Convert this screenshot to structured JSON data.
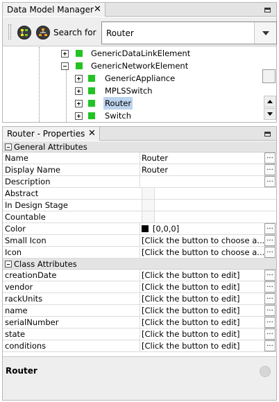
{
  "tree_panel": {
    "tab_title": "Data Model Manager",
    "close_glyph": "✕",
    "search_label": "Search for",
    "search_value": "Router",
    "tree_items": [
      {
        "label": "GenericDataLinkElement",
        "expander": "plus"
      },
      {
        "label": "GenericNetworkElement",
        "expander": "minus"
      },
      {
        "label": "GenericAppliance",
        "expander": "plus"
      },
      {
        "label": "MPLSSwitch",
        "expander": "plus"
      },
      {
        "label": "Router",
        "expander": "plus",
        "selected": true
      },
      {
        "label": "Switch",
        "expander": "plus"
      }
    ],
    "node_color": "#22c322",
    "selection_color": "#bcd3ee"
  },
  "properties_panel": {
    "tab_title": "Router - Properties",
    "close_glyph": "✕",
    "general_header": "General Attributes",
    "general_rows": [
      {
        "name": "Name",
        "value": "Router",
        "editor": true
      },
      {
        "name": "Display Name",
        "value": "Router",
        "editor": true
      },
      {
        "name": "Description",
        "value": "",
        "editor": true
      },
      {
        "name": "Abstract",
        "checkbox": true
      },
      {
        "name": "In Design Stage",
        "checkbox": true
      },
      {
        "name": "Countable",
        "checkbox": true
      },
      {
        "name": "Color",
        "value": "[0,0,0]",
        "editor": true,
        "swatch": "#000000"
      },
      {
        "name": "Small Icon",
        "value": "[Click the button to choose a...",
        "editor": true
      },
      {
        "name": "Icon",
        "value": "[Click the button to choose a...",
        "editor": true
      }
    ],
    "class_header": "Class Attributes",
    "class_rows": [
      {
        "name": "creationDate",
        "value": "[Click the button to edit]"
      },
      {
        "name": "vendor",
        "value": "[Click the button to edit]"
      },
      {
        "name": "rackUnits",
        "value": "[Click the button to edit]"
      },
      {
        "name": "name",
        "value": "[Click the button to edit]"
      },
      {
        "name": "serialNumber",
        "value": "[Click the button to edit]"
      },
      {
        "name": "state",
        "value": "[Click the button to edit]"
      },
      {
        "name": "conditions",
        "value": "[Click the button to edit]"
      }
    ],
    "editor_glyph": "...",
    "summary_title": "Router"
  },
  "icons": [
    "close-icon",
    "minimize-icon",
    "expand-tree-icon",
    "hierarchy-icon",
    "dropdown-arrow-icon",
    "scroll-up-icon",
    "scroll-down-icon",
    "help-icon"
  ]
}
